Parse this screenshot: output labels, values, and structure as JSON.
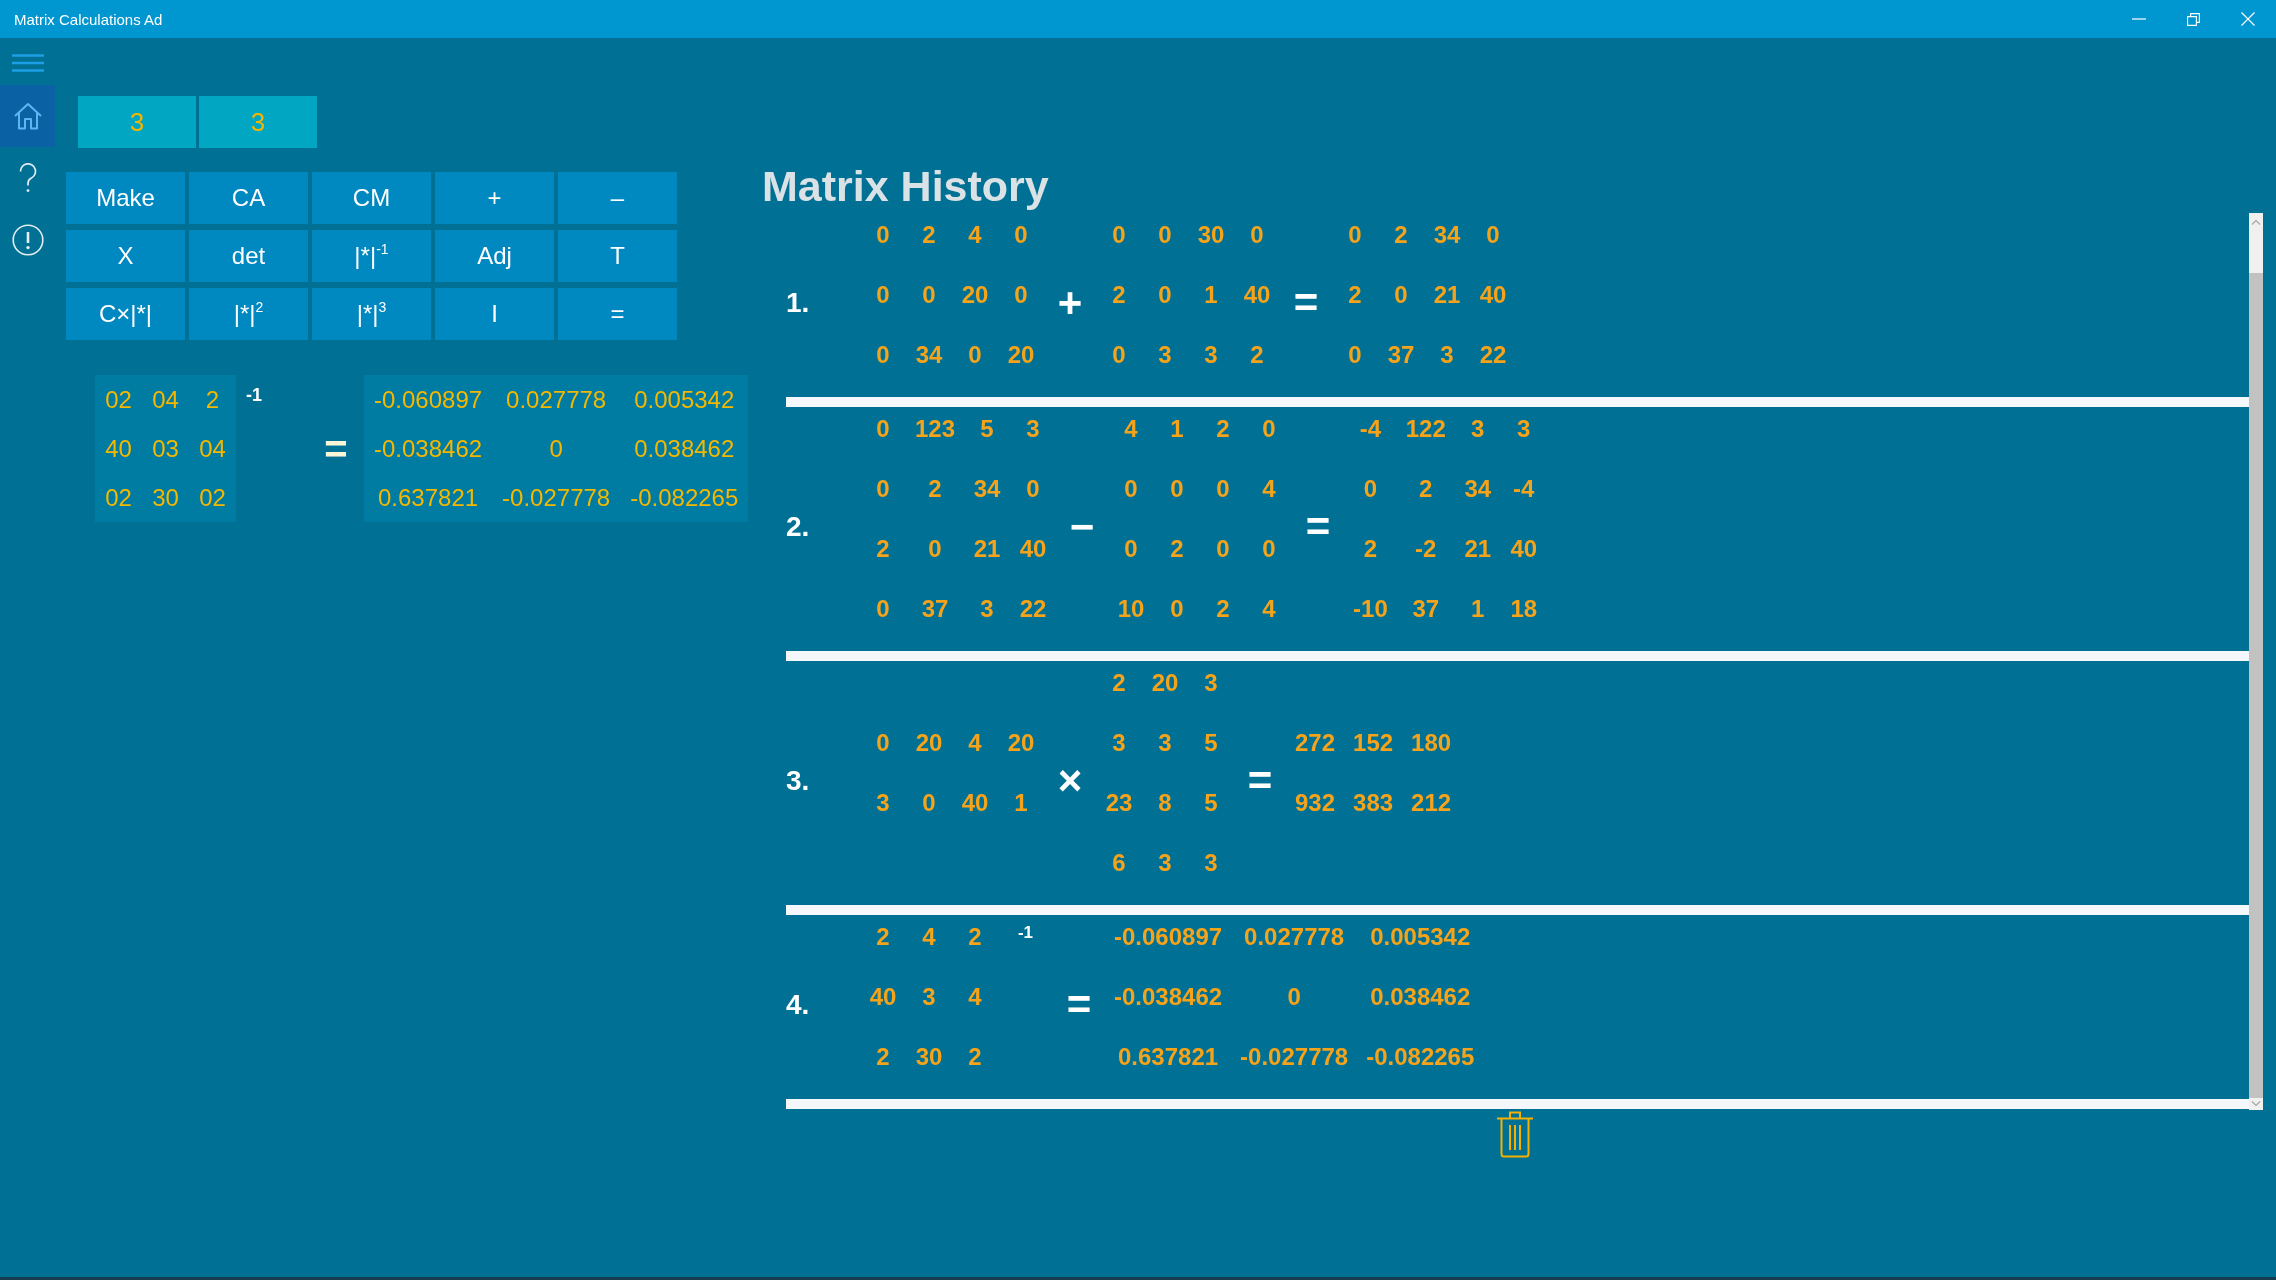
{
  "window": {
    "title": "Matrix Calculations Ad"
  },
  "sidebar": {
    "items": [
      {
        "selected": true
      },
      {
        "selected": false
      },
      {
        "selected": false
      }
    ]
  },
  "dimension_fields": [
    {
      "value": "3"
    },
    {
      "value": "3"
    }
  ],
  "keypad": {
    "buttons": [
      "Make",
      "CA",
      "CM",
      "+",
      "–",
      "X",
      "det",
      "|*|$^{-1}$",
      "Adj",
      "T",
      "C×|*|",
      "|*|$^{2}$",
      "|*|$^{3}$",
      "I",
      "="
    ]
  },
  "workspace": {
    "terms": [
      {
        "kind": "matrix",
        "rows": [
          [
            "02",
            "04",
            "2"
          ],
          [
            "40",
            "03",
            "04"
          ],
          [
            "02",
            "30",
            "02"
          ]
        ]
      },
      {
        "kind": "power",
        "text": "-1"
      },
      {
        "kind": "operator",
        "text": "="
      },
      {
        "kind": "matrix",
        "rows": [
          [
            "-0.060897",
            "0.027778",
            "0.005342"
          ],
          [
            "-0.038462",
            "0",
            "0.038462"
          ],
          [
            "0.637821",
            "-0.027778",
            "-0.082265"
          ]
        ]
      }
    ]
  },
  "history": {
    "title": "Matrix History",
    "entries": [
      {
        "index": "1.",
        "terms": [
          {
            "kind": "matrix",
            "rows": [
              [
                "0",
                "2",
                "4",
                "0"
              ],
              [
                "0",
                "0",
                "20",
                "0"
              ],
              [
                "0",
                "34",
                "0",
                "20"
              ]
            ]
          },
          {
            "kind": "operator",
            "text": "+"
          },
          {
            "kind": "matrix",
            "rows": [
              [
                "0",
                "0",
                "30",
                "0"
              ],
              [
                "2",
                "0",
                "1",
                "40"
              ],
              [
                "0",
                "3",
                "3",
                "2"
              ]
            ]
          },
          {
            "kind": "operator",
            "text": "="
          },
          {
            "kind": "matrix",
            "rows": [
              [
                "0",
                "2",
                "34",
                "0"
              ],
              [
                "2",
                "0",
                "21",
                "40"
              ],
              [
                "0",
                "37",
                "3",
                "22"
              ]
            ]
          }
        ]
      },
      {
        "index": "2.",
        "terms": [
          {
            "kind": "matrix",
            "rows": [
              [
                "0",
                "123",
                "5",
                "3"
              ],
              [
                "0",
                "2",
                "34",
                "0"
              ],
              [
                "2",
                "0",
                "21",
                "40"
              ],
              [
                "0",
                "37",
                "3",
                "22"
              ]
            ]
          },
          {
            "kind": "operator",
            "text": "−"
          },
          {
            "kind": "matrix",
            "rows": [
              [
                "4",
                "1",
                "2",
                "0"
              ],
              [
                "0",
                "0",
                "0",
                "4"
              ],
              [
                "0",
                "2",
                "0",
                "0"
              ],
              [
                "10",
                "0",
                "2",
                "4"
              ]
            ]
          },
          {
            "kind": "operator",
            "text": "="
          },
          {
            "kind": "matrix",
            "rows": [
              [
                "-4",
                "122",
                "3",
                "3"
              ],
              [
                "0",
                "2",
                "34",
                "-4"
              ],
              [
                "2",
                "-2",
                "21",
                "40"
              ],
              [
                "-10",
                "37",
                "1",
                "18"
              ]
            ]
          }
        ]
      },
      {
        "index": "3.",
        "terms": [
          {
            "kind": "matrix",
            "rows": [
              [
                "0",
                "20",
                "4",
                "20"
              ],
              [
                "3",
                "0",
                "40",
                "1"
              ]
            ]
          },
          {
            "kind": "operator",
            "text": "×"
          },
          {
            "kind": "matrix",
            "rows": [
              [
                "2",
                "20",
                "3"
              ],
              [
                "3",
                "3",
                "5"
              ],
              [
                "23",
                "8",
                "5"
              ],
              [
                "6",
                "3",
                "3"
              ]
            ]
          },
          {
            "kind": "operator",
            "text": "="
          },
          {
            "kind": "matrix",
            "rows": [
              [
                "272",
                "152",
                "180"
              ],
              [
                "932",
                "383",
                "212"
              ]
            ]
          }
        ]
      },
      {
        "index": "4.",
        "terms": [
          {
            "kind": "matrix",
            "rows": [
              [
                "2",
                "4",
                "2"
              ],
              [
                "40",
                "3",
                "4"
              ],
              [
                "2",
                "30",
                "2"
              ]
            ]
          },
          {
            "kind": "power",
            "text": "-1"
          },
          {
            "kind": "operator",
            "text": "="
          },
          {
            "kind": "matrix",
            "rows": [
              [
                "-0.060897",
                "0.027778",
                "0.005342"
              ],
              [
                "-0.038462",
                "0",
                "0.038462"
              ],
              [
                "0.637821",
                "-0.027778",
                "-0.082265"
              ]
            ]
          }
        ]
      }
    ]
  }
}
